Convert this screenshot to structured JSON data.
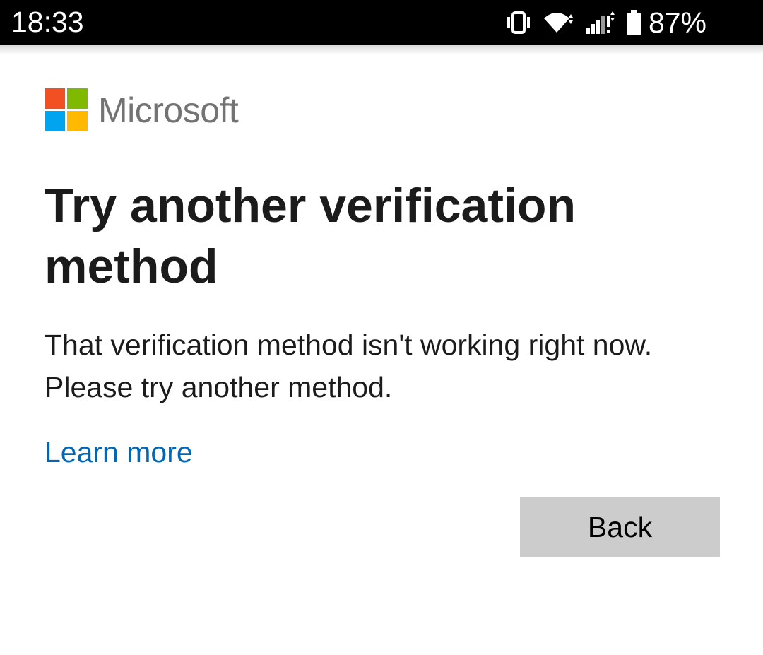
{
  "status_bar": {
    "time": "18:33",
    "battery_percent": "87%",
    "icons": [
      "vibrate-icon",
      "wifi-icon",
      "cellular-signal-icon",
      "battery-icon"
    ]
  },
  "brand": {
    "name": "Microsoft",
    "logo_colors": [
      "#f25022",
      "#7fba00",
      "#00a4ef",
      "#ffb900"
    ]
  },
  "main": {
    "title": "Try another verification method",
    "message": "That verification method isn't working right now. Please try another method.",
    "learn_more_label": "Learn more",
    "back_button_label": "Back"
  },
  "colors": {
    "link": "#0067b8",
    "button_bg": "#cccccc",
    "text": "#1b1b1b"
  }
}
